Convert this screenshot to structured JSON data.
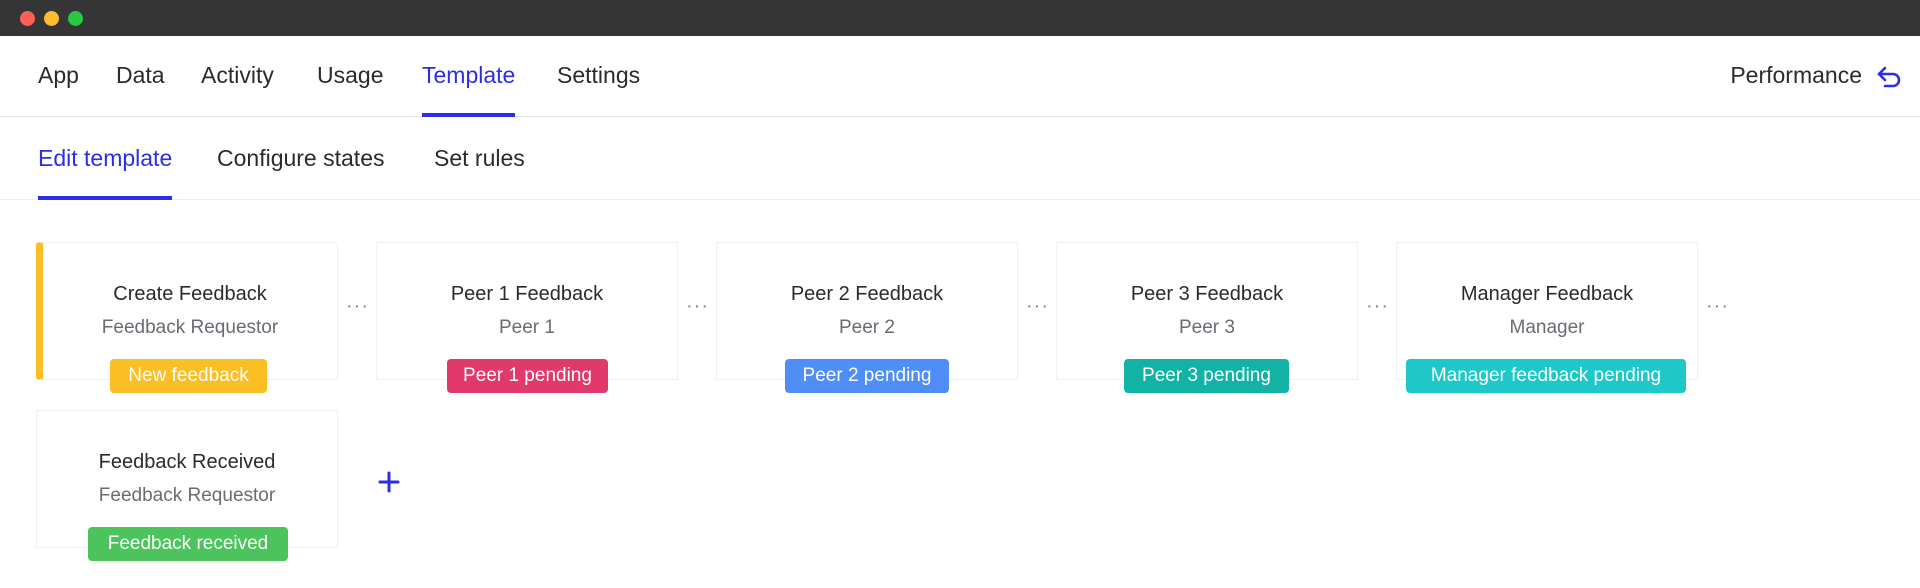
{
  "window": {
    "controls": [
      "close",
      "minimize",
      "maximize"
    ]
  },
  "top_nav": {
    "tabs": [
      {
        "label": "App"
      },
      {
        "label": "Data"
      },
      {
        "label": "Activity"
      },
      {
        "label": "Usage"
      },
      {
        "label": "Template",
        "active": true
      },
      {
        "label": "Settings"
      }
    ],
    "right_label": "Performance",
    "right_icon": "undo-icon"
  },
  "sub_nav": {
    "tabs": [
      {
        "label": "Edit template",
        "active": true
      },
      {
        "label": "Configure states"
      },
      {
        "label": "Set rules"
      }
    ]
  },
  "steps": [
    {
      "name": "Create Feedback",
      "role": "Feedback Requestor",
      "badge": "New feedback",
      "badge_color": "#fbbf24",
      "active": true
    },
    {
      "name": "Peer 1 Feedback",
      "role": "Peer 1",
      "badge": "Peer 1 pending",
      "badge_color": "#e2396d"
    },
    {
      "name": "Peer 2 Feedback",
      "role": "Peer 2",
      "badge": "Peer 2 pending",
      "badge_color": "#4f8ef7"
    },
    {
      "name": "Peer 3 Feedback",
      "role": "Peer 3",
      "badge": "Peer 3 pending",
      "badge_color": "#12b3a4"
    },
    {
      "name": "Manager Feedback",
      "role": "Manager",
      "badge": "Manager feedback pending",
      "badge_color": "#1ec8c8"
    },
    {
      "name": "Feedback Received",
      "role": "Feedback Requestor",
      "badge": "Feedback received",
      "badge_color": "#4cc35c"
    }
  ],
  "step_menu_label": "···",
  "add_step_icon": "plus-icon",
  "colors": {
    "accent": "#2b2ee8",
    "first_step_marker": "#fbbf24"
  }
}
